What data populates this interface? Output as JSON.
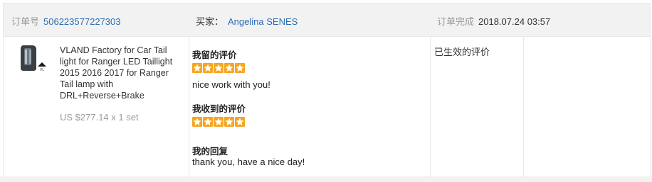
{
  "header": {
    "order_label": "订单号",
    "order_number": "506223577227303",
    "buyer_label": "买家：",
    "buyer_name": "Angelina SENES",
    "completed_label": "订单完成",
    "completed_time": "2018.07.24 03:57"
  },
  "product": {
    "title": "VLAND Factory for Car Tail light for Ranger LED Taillight 2015 2016 2017 for Ranger Tail lamp with DRL+Reverse+Brake",
    "price_qty": "US $277.14 x 1 set",
    "image_icon": "tail-light-product-icon"
  },
  "reviews": {
    "left_label": "我留的评价",
    "left_stars": 5,
    "left_text": "nice work with you!",
    "received_label": "我收到的评价",
    "received_stars": 5,
    "reply_label": "我的回复",
    "reply_text": "thank you, have a nice day!"
  },
  "status": "已生效的评价",
  "colors": {
    "link": "#2a6cb3",
    "star": "#f5a623",
    "header_bg": "#f2f2f2"
  }
}
